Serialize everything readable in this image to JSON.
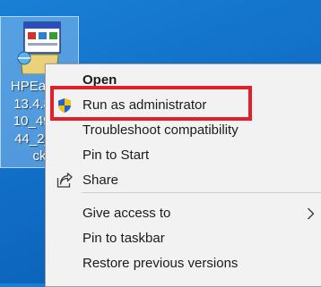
{
  "desktop_icon": {
    "name_lines": [
      "HPEasyS",
      "13.4.8-C",
      "10_49_1",
      "44_2_W",
      "ck"
    ]
  },
  "context_menu": {
    "items": [
      {
        "label": "Open",
        "bold": true,
        "icon": null
      },
      {
        "label": "Run as administrator",
        "icon": "uac-shield-icon"
      },
      {
        "label": "Troubleshoot compatibility",
        "icon": null
      },
      {
        "label": "Pin to Start",
        "icon": null
      },
      {
        "label": "Share",
        "icon": "share-icon"
      },
      {
        "label": "Give access to",
        "icon": null,
        "submenu": true
      },
      {
        "label": "Pin to taskbar",
        "icon": null
      },
      {
        "label": "Restore previous versions",
        "icon": null
      }
    ]
  },
  "colors": {
    "desktop_background": "#0f6bc4",
    "menu_background": "#f2f2f2",
    "highlight_border": "#e0202b",
    "shield_blue": "#2563c4",
    "shield_yellow": "#f2c21b"
  }
}
